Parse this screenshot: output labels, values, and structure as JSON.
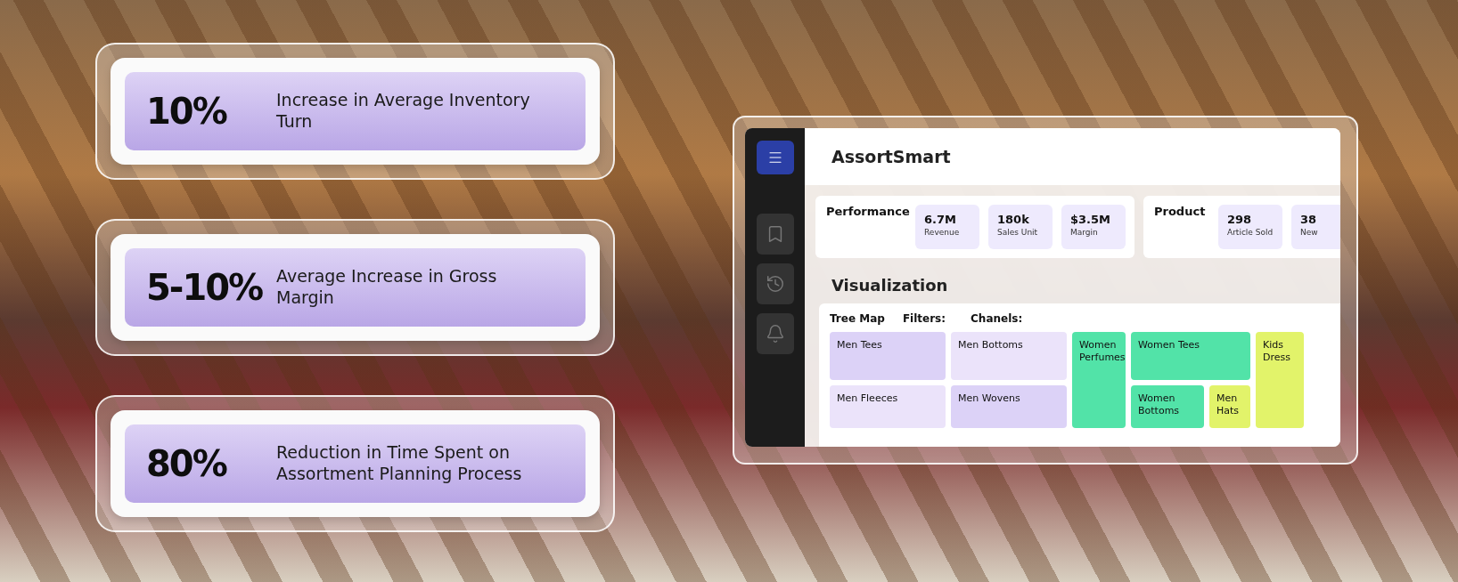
{
  "stats": [
    {
      "value": "10%",
      "description": "Increase in Average Inventory Turn"
    },
    {
      "value": "5-10%",
      "description": "Average Increase in Gross Margin"
    },
    {
      "value": "80%",
      "description": "Reduction in Time Spent on Assortment Planning Process"
    }
  ],
  "app": {
    "title": "AssortSmart",
    "nav": [
      {
        "kind": "menu",
        "selected": true
      },
      {
        "kind": "bookmark",
        "selected": false
      },
      {
        "kind": "history",
        "selected": false
      },
      {
        "kind": "bell",
        "selected": false
      }
    ],
    "metric_groups": [
      {
        "title": "Performance",
        "metrics": [
          {
            "value": "6.7M",
            "label": "Revenue"
          },
          {
            "value": "180k",
            "label": "Sales Unit"
          },
          {
            "value": "$3.5M",
            "label": "Margin"
          }
        ]
      },
      {
        "title": "Product",
        "metrics": [
          {
            "value": "298",
            "label": "Article Sold"
          },
          {
            "value": "38",
            "label": "New"
          }
        ]
      }
    ],
    "visualization": {
      "title": "Visualization",
      "controls": [
        "Tree Map",
        "Filters:",
        "Chanels:"
      ],
      "tiles": [
        {
          "label": "Men Tees",
          "color": "#dcd2f7"
        },
        {
          "label": "Men Fleeces",
          "color": "#ebe3fa"
        },
        {
          "label": "Men Bottoms",
          "color": "#ebe3fa"
        },
        {
          "label": "Men Wovens",
          "color": "#dcd2f7"
        },
        {
          "label": "Women Perfumes",
          "color": "#52e3a8"
        },
        {
          "label": "Women Tees",
          "color": "#52e3a8"
        },
        {
          "label": "Women Bottoms",
          "color": "#52e3a8"
        },
        {
          "label": "Men Hats",
          "color": "#e2f36a"
        },
        {
          "label": "Kids Dress",
          "color": "#e2f36a"
        }
      ]
    }
  }
}
